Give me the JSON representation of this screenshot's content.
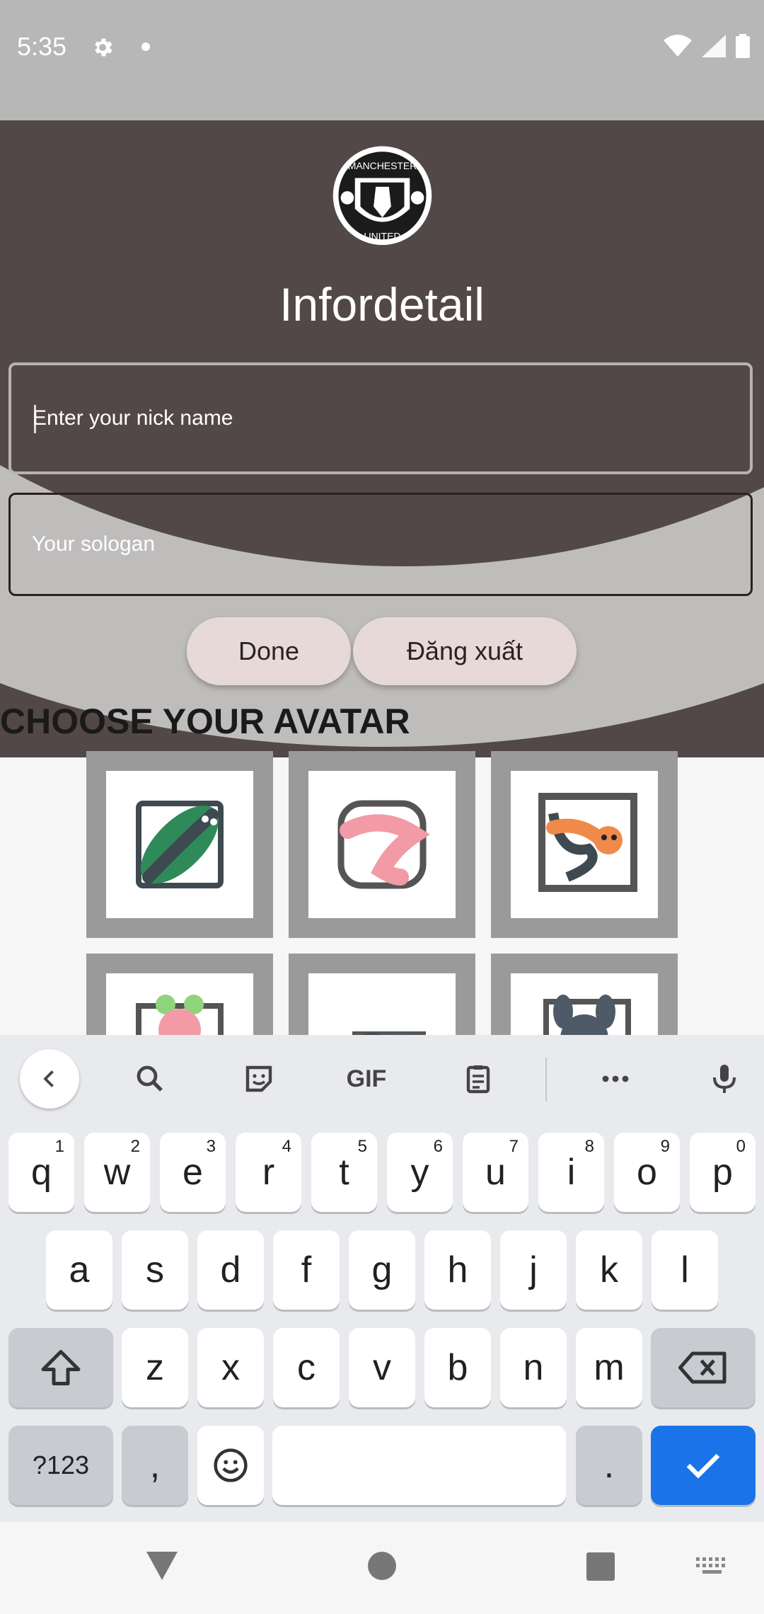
{
  "status_bar": {
    "time": "5:35",
    "left_icons": [
      "gear-icon",
      "dot-icon"
    ],
    "right_icons": [
      "wifi-icon",
      "cellular-signal-icon",
      "battery-icon"
    ]
  },
  "app": {
    "logo": "manchester-united-crest-logo",
    "logo_text": [
      "MANCHESTER",
      "UNITED"
    ],
    "title": "Infordetail",
    "nickname_field": {
      "placeholder": "Enter your nick name",
      "value": ""
    },
    "slogan_field": {
      "placeholder": "Your sologan",
      "value": ""
    },
    "done_button": "Done",
    "logout_button": "Đăng xuất",
    "avatar_section_title": "CHOOSE YOUR AVATAR",
    "avatars": [
      "caterpillar-leaf-avatar",
      "pink-worm-avatar",
      "orange-worm-avatar",
      "pink-bunny-avatar",
      "grey-creature-avatar",
      "grey-bunny-avatar"
    ],
    "colors": {
      "header_dark": "#534848",
      "accent_circle": "#bfbcbc",
      "button_bg": "#e8d9d9",
      "avatar_border": "#9a9a9a"
    }
  },
  "keyboard": {
    "toolbar": {
      "back": "chevron-left-icon",
      "search": "search-icon",
      "sticker": "sticker-icon",
      "gif": "GIF",
      "clipboard": "clipboard-icon",
      "more": "more-icon",
      "mic": "microphone-icon"
    },
    "row1": [
      {
        "k": "q",
        "s": "1"
      },
      {
        "k": "w",
        "s": "2"
      },
      {
        "k": "e",
        "s": "3"
      },
      {
        "k": "r",
        "s": "4"
      },
      {
        "k": "t",
        "s": "5"
      },
      {
        "k": "y",
        "s": "6"
      },
      {
        "k": "u",
        "s": "7"
      },
      {
        "k": "i",
        "s": "8"
      },
      {
        "k": "o",
        "s": "9"
      },
      {
        "k": "p",
        "s": "0"
      }
    ],
    "row2": [
      "a",
      "s",
      "d",
      "f",
      "g",
      "h",
      "j",
      "k",
      "l"
    ],
    "row3": [
      "z",
      "x",
      "c",
      "v",
      "b",
      "n",
      "m"
    ],
    "symbols_key": "?123",
    "comma_key": ",",
    "period_key": ".",
    "shift": "shift-icon",
    "backspace": "backspace-icon",
    "emoji": "emoji-icon",
    "enter": "checkmark-icon",
    "accent_color": "#1a73e8"
  },
  "nav_bar": {
    "back": "back-triangle-icon",
    "home": "home-circle-icon",
    "recents": "recents-square-icon",
    "keyboard": "keyboard-icon"
  }
}
